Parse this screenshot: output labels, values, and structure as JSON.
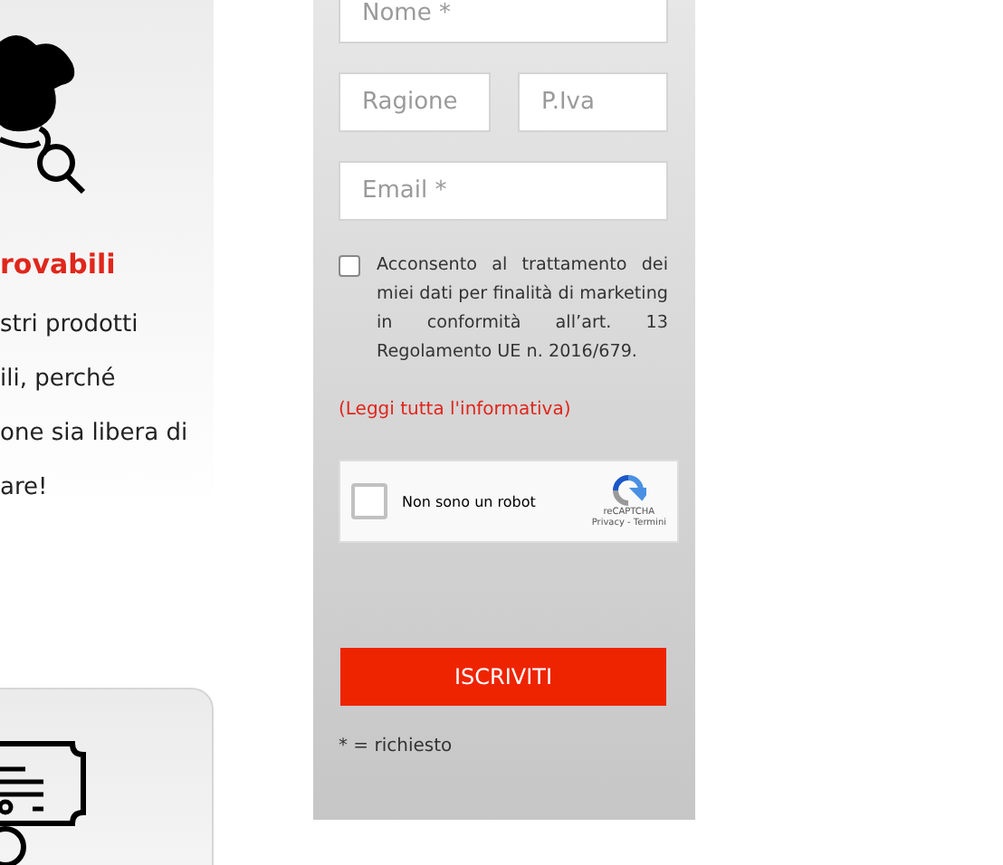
{
  "feature_card": {
    "title": "rovabili",
    "lines": [
      "stri prodotti",
      "ili, perché",
      "one sia libera di",
      "are!"
    ]
  },
  "signup_form": {
    "fields": [
      {
        "placeholder": "Nome *"
      },
      {
        "placeholder": "Ragione"
      },
      {
        "placeholder": "P.Iva"
      },
      {
        "placeholder": "Email *"
      }
    ],
    "consent": {
      "checked": false,
      "text": "Acconsento al trattamento dei miei dati per finalità di marketing in conformità all’art. 13 Regolamento UE n. 2016/679."
    },
    "policy_link": "(Leggi tutta l'informativa)",
    "captcha": {
      "checked": false,
      "label": "Non sono un robot",
      "brand": "reCAPTCHA",
      "links": "Privacy - Termini"
    },
    "submit": "ISCRIVITI",
    "required_note": "* = richiesto"
  }
}
